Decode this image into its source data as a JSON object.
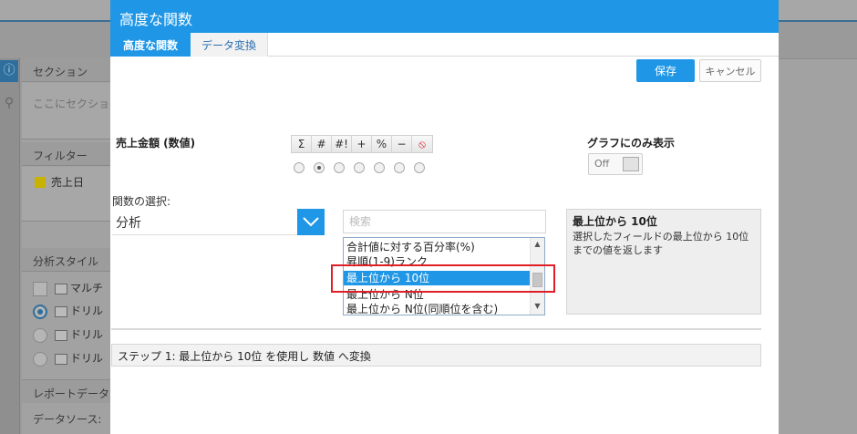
{
  "background": {
    "section_header": "セクション",
    "section_placeholder": "ここにセクション",
    "filter_header": "フィルター",
    "filter_item": "売上日",
    "analysis_header": "分析スタイル",
    "analysis_items": [
      "マルチ",
      "ドリル",
      "ドリル",
      "ドリル"
    ],
    "report_header": "レポートデータ",
    "datasource_label": "データソース:"
  },
  "dialog": {
    "title": "高度な関数",
    "tabs": [
      "高度な関数",
      "データ変換"
    ],
    "save_label": "保存",
    "cancel_label": "キャンセル",
    "field_title": "売上金額 (数値)",
    "toolbar_buttons": [
      "Σ",
      "#",
      "#!",
      "+",
      "%",
      "−"
    ],
    "graph_only_label": "グラフにのみ表示",
    "toggle_state": "Off",
    "function_select_label": "関数の選択:",
    "function_select_value": "分析",
    "search_placeholder": "検索",
    "function_list": [
      "合計値に対する百分率(%)",
      "昇順(1-9)ランク",
      "最上位から 10位",
      "最上位から N位",
      "最上位から N位(同順位を含む)"
    ],
    "selected_function_index": 2,
    "description": {
      "title": "最上位から 10位",
      "text": "選択したフィールドの最上位から 10位までの値を返します"
    },
    "step_text": "ステップ 1: 最上位から 10位 を使用し 数値 へ変換"
  },
  "colors": {
    "accent": "#1f97e6",
    "highlight": "#e01e25"
  }
}
